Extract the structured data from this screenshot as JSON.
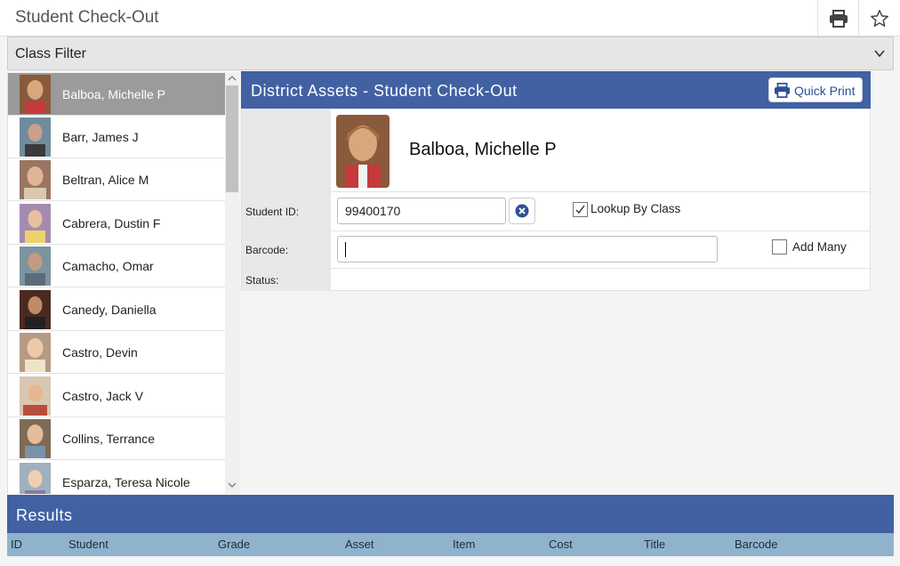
{
  "page": {
    "title": "Student Check-Out",
    "toolbar": {
      "print_icon": "print-icon",
      "favorite_icon": "star-icon"
    }
  },
  "class_filter": {
    "label": "Class Filter",
    "icon": "chevron-down-icon"
  },
  "students": [
    {
      "name": "Balboa, Michelle P",
      "selected": true
    },
    {
      "name": "Barr, James J"
    },
    {
      "name": "Beltran, Alice M"
    },
    {
      "name": "Cabrera, Dustin F"
    },
    {
      "name": "Camacho, Omar"
    },
    {
      "name": "Canedy, Daniella"
    },
    {
      "name": "Castro, Devin"
    },
    {
      "name": "Castro, Jack V"
    },
    {
      "name": "Collins, Terrance"
    },
    {
      "name": "Esparza, Teresa Nicole"
    }
  ],
  "checkout": {
    "title": "District Assets - Student Check-Out",
    "quick_print_label": "Quick Print",
    "selected_student": "Balboa, Michelle P",
    "student_id_label": "Student ID:",
    "student_id_value": "99400170",
    "lookup_by_class_label": "Lookup By Class",
    "lookup_by_class_checked": true,
    "barcode_label": "Barcode:",
    "barcode_value": "",
    "add_many_label": "Add Many",
    "add_many_checked": false,
    "status_label": "Status:",
    "status_value": ""
  },
  "results": {
    "title": "Results",
    "columns": [
      "ID",
      "Student",
      "Grade",
      "Asset",
      "Item",
      "Cost",
      "Title",
      "Barcode"
    ]
  },
  "colors": {
    "header_blue": "#4161a3",
    "results_columns_bg": "#8fb3cc",
    "selected_row_bg": "#9b9b9b",
    "clear_icon": "#2d4f95"
  }
}
